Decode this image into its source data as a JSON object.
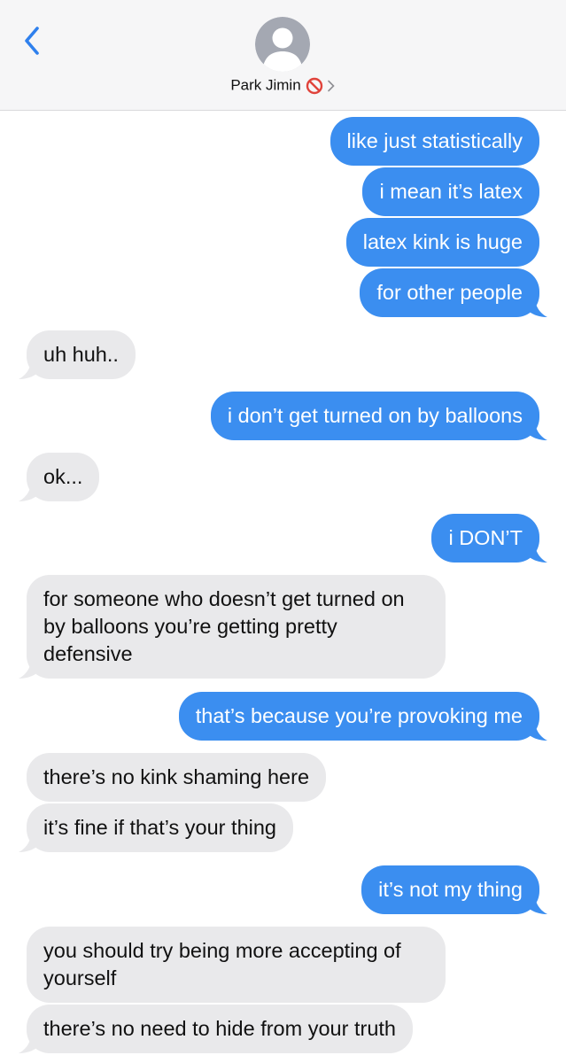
{
  "header": {
    "contact_name": "Park Jimin",
    "contact_emoji": "prohibited-icon",
    "back_icon": "chevron-left-icon",
    "disclosure_icon": "chevron-right-icon"
  },
  "colors": {
    "sent_bubble": "#3b8ef0",
    "received_bubble": "#e9e9eb",
    "accent": "#2f80ed"
  },
  "messages": [
    {
      "from": "me",
      "text": "like just statistically"
    },
    {
      "from": "me",
      "text": "i mean it’s latex"
    },
    {
      "from": "me",
      "text": "latex kink is huge"
    },
    {
      "from": "me",
      "text": "for other people"
    },
    {
      "from": "them",
      "text": "uh huh.."
    },
    {
      "from": "me",
      "text": "i don’t get turned on by balloons"
    },
    {
      "from": "them",
      "text": "ok..."
    },
    {
      "from": "me",
      "text": "i DON’T"
    },
    {
      "from": "them",
      "text": "for someone who doesn’t get turned on by balloons you’re getting pretty defensive"
    },
    {
      "from": "me",
      "text": "that’s because you’re provoking me"
    },
    {
      "from": "them",
      "text": "there’s no kink shaming here"
    },
    {
      "from": "them",
      "text": "it’s fine if that’s your thing"
    },
    {
      "from": "me",
      "text": "it’s not my thing"
    },
    {
      "from": "them",
      "text": "you should try being more accepting of yourself"
    },
    {
      "from": "them",
      "text": "there’s no need to hide from your truth"
    }
  ]
}
